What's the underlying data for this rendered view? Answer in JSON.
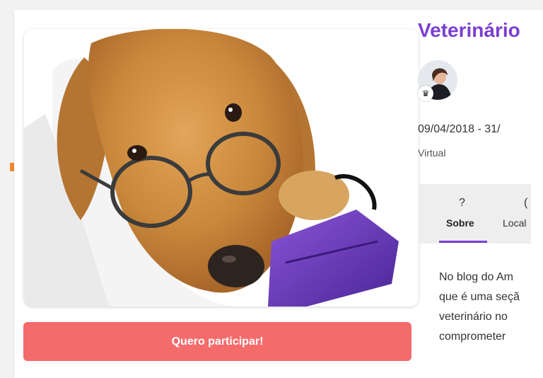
{
  "event": {
    "title": "Veterinário",
    "date": "09/04/2018 - 31/",
    "mode": "Virtual",
    "cta_label": "Quero participar!"
  },
  "host": {
    "badge_icon": "crown-icon"
  },
  "tabs": [
    {
      "icon": "?",
      "label": "Sobre",
      "active": true
    },
    {
      "icon": "(",
      "label": "Local",
      "active": false
    }
  ],
  "description": {
    "lines": [
      "No blog do Am",
      "que é uma seçã",
      "veterinário no",
      "comprometer"
    ]
  },
  "colors": {
    "accent": "#7a3fd0",
    "cta": "#f46b6c"
  }
}
